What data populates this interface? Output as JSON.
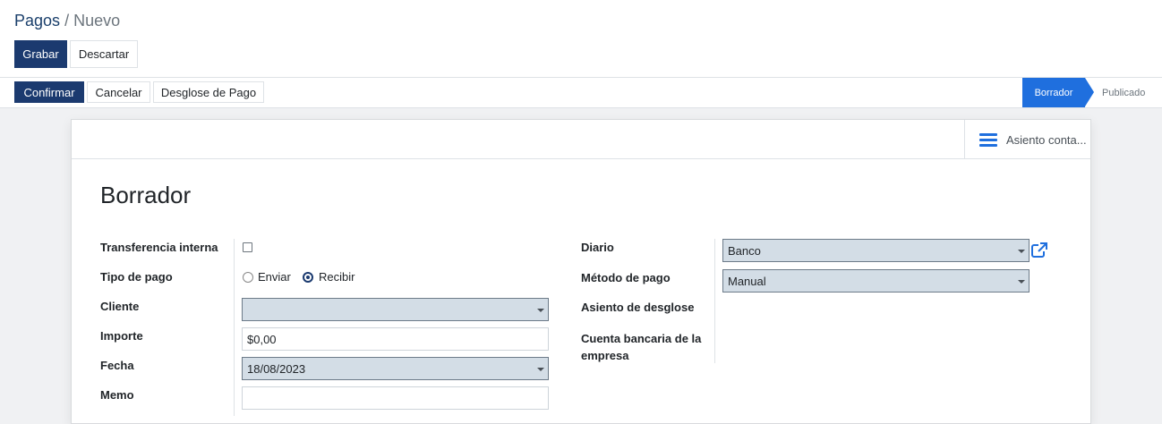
{
  "breadcrumb": {
    "parent": "Pagos",
    "separator": "/",
    "current": "Nuevo"
  },
  "control_buttons": {
    "save": "Grabar",
    "discard": "Descartar"
  },
  "statusbar": {
    "actions": {
      "confirm": "Confirmar",
      "cancel": "Cancelar",
      "breakdown": "Desglose de Pago"
    },
    "stages": {
      "active": "Borrador",
      "next": "Publicado"
    }
  },
  "smart_button": {
    "label": "Asiento conta...",
    "icon": "list-icon"
  },
  "form": {
    "title": "Borrador",
    "left": {
      "internal_transfer_label": "Transferencia interna",
      "internal_transfer_checked": false,
      "payment_type_label": "Tipo de pago",
      "payment_type_options": {
        "send": "Enviar",
        "receive": "Recibir"
      },
      "payment_type_selected": "Recibir",
      "customer_label": "Cliente",
      "customer_value": "",
      "amount_label": "Importe",
      "amount_value": "$0,00",
      "date_label": "Fecha",
      "date_value": "18/08/2023",
      "memo_label": "Memo",
      "memo_value": ""
    },
    "right": {
      "journal_label": "Diario",
      "journal_value": "Banco",
      "method_label": "Método de pago",
      "method_value": "Manual",
      "breakdown_entry_label": "Asiento de desglose",
      "bank_account_label": "Cuenta bancaria de la empresa"
    }
  },
  "colors": {
    "primary": "#1b3a6f",
    "accent": "#1f6fde",
    "field_bg": "#d3dde6"
  }
}
